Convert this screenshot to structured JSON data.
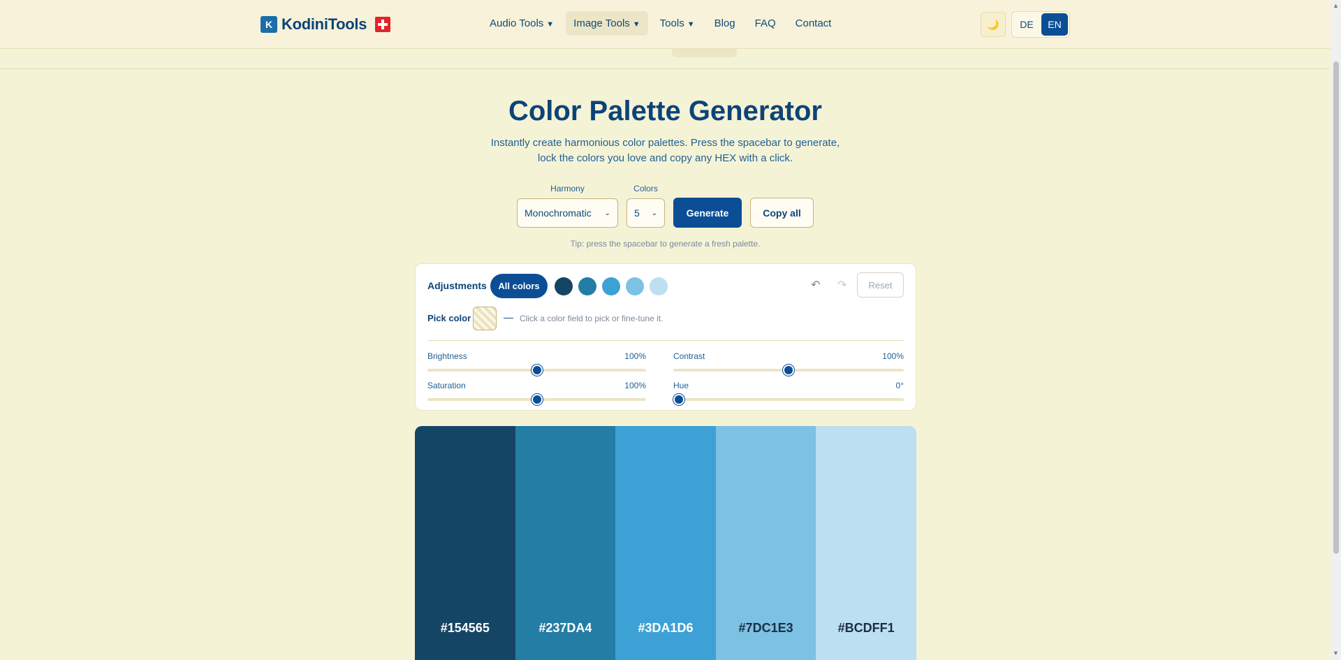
{
  "nav": {
    "brand": "KodiniTools",
    "brand_mark": "K",
    "links": [
      {
        "label": "Audio Tools",
        "caret": "▼",
        "active": false
      },
      {
        "label": "Image Tools",
        "caret": "▼",
        "active": true
      },
      {
        "label": "Tools",
        "caret": "▼",
        "active": false
      },
      {
        "label": "Blog",
        "caret": "",
        "active": false
      },
      {
        "label": "FAQ",
        "caret": "",
        "active": false
      },
      {
        "label": "Contact",
        "caret": "",
        "active": false
      }
    ],
    "theme_icon": "🌙",
    "lang": {
      "de": "DE",
      "en": "EN",
      "active": "EN"
    }
  },
  "hero": {
    "title": "Color Palette Generator",
    "subtitle_line1": "Instantly create harmonious color palettes. Press the spacebar to generate,",
    "subtitle_line2": "lock the colors you love and copy any HEX with a click."
  },
  "controls": {
    "harmony_label": "Harmony",
    "harmony_value": "Monochromatic",
    "colors_label": "Colors",
    "colors_value": "5",
    "generate_label": "Generate",
    "copy_all_label": "Copy all",
    "tip": "Tip: press the spacebar to generate a fresh palette."
  },
  "adjustments": {
    "label": "Adjustments",
    "all_colors_label": "All colors",
    "undo_icon": "↶",
    "redo_icon": "↷",
    "reset_label": "Reset",
    "pick_label": "Pick color",
    "pick_dash": "—",
    "pick_hint": "Click a color field to pick or fine-tune it.",
    "sliders": {
      "brightness": {
        "label": "Brightness",
        "value": "100%",
        "fraction": 0.5
      },
      "contrast": {
        "label": "Contrast",
        "value": "100%",
        "fraction": 0.5
      },
      "saturation": {
        "label": "Saturation",
        "value": "100%",
        "fraction": 0.5
      },
      "hue": {
        "label": "Hue",
        "value": "0°",
        "fraction": 0.0
      }
    }
  },
  "palette": [
    {
      "hex": "#154565",
      "text_color": "#ffffff"
    },
    {
      "hex": "#237DA4",
      "text_color": "#ffffff"
    },
    {
      "hex": "#3DA1D6",
      "text_color": "#ffffff"
    },
    {
      "hex": "#7DC1E3",
      "text_color": "#1a2e44"
    },
    {
      "hex": "#BCDFF1",
      "text_color": "#1a2e44"
    }
  ]
}
